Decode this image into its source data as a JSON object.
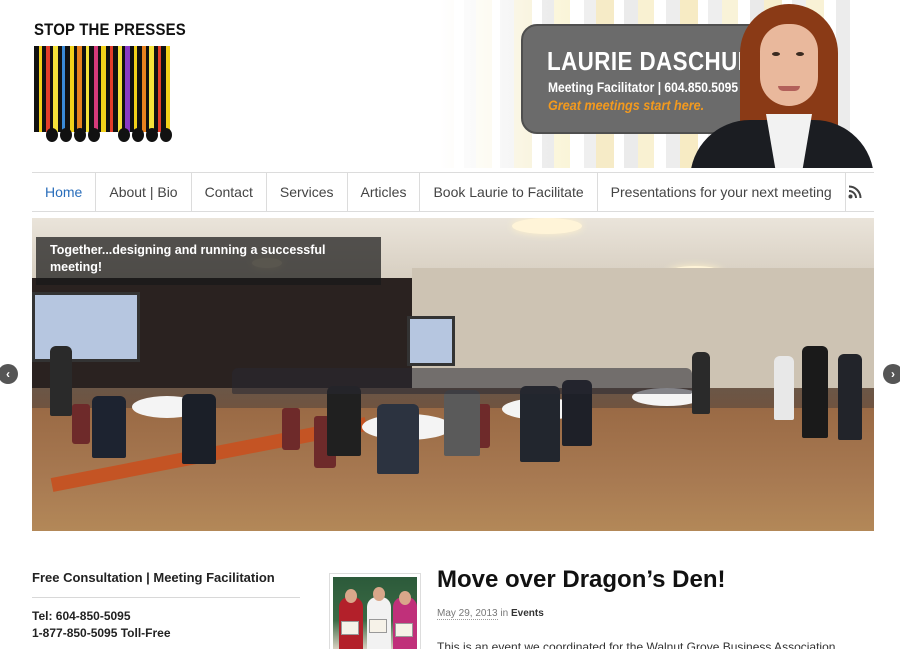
{
  "header": {
    "logo_text": "STOP THE PRESSES",
    "name": "LAURIE DASCHUK",
    "role": "Meeting Facilitator  |  604.850.5095",
    "tagline": "Great meetings start here.",
    "tagline_color": "#f39a1e",
    "card_color": "#6b6b6b"
  },
  "nav": {
    "items": [
      {
        "label": "Home",
        "active": true
      },
      {
        "label": "About | Bio"
      },
      {
        "label": "Contact"
      },
      {
        "label": "Services"
      },
      {
        "label": "Articles"
      },
      {
        "label": "Book Laurie to Facilitate"
      },
      {
        "label": "Presentations for your next meeting"
      }
    ],
    "rss_icon": "rss-icon",
    "active_color": "#2a6ebb"
  },
  "slider": {
    "caption": "Together...designing and running a successful meeting!",
    "prev_icon": "chevron-left-icon",
    "next_icon": "chevron-right-icon",
    "prev_glyph": "‹",
    "next_glyph": "›"
  },
  "sidebar": {
    "title": "Free Consultation | Meeting Facilitation",
    "phone": "Tel: 604-850-5095",
    "tollfree": "1-877-850-5095 Toll-Free"
  },
  "post": {
    "title": "Move over Dragon’s Den!",
    "date": "May 29, 2013",
    "in_word": "in",
    "category": "Events",
    "excerpt": "This is an event we coordinated for the Walnut Grove Business Association"
  }
}
